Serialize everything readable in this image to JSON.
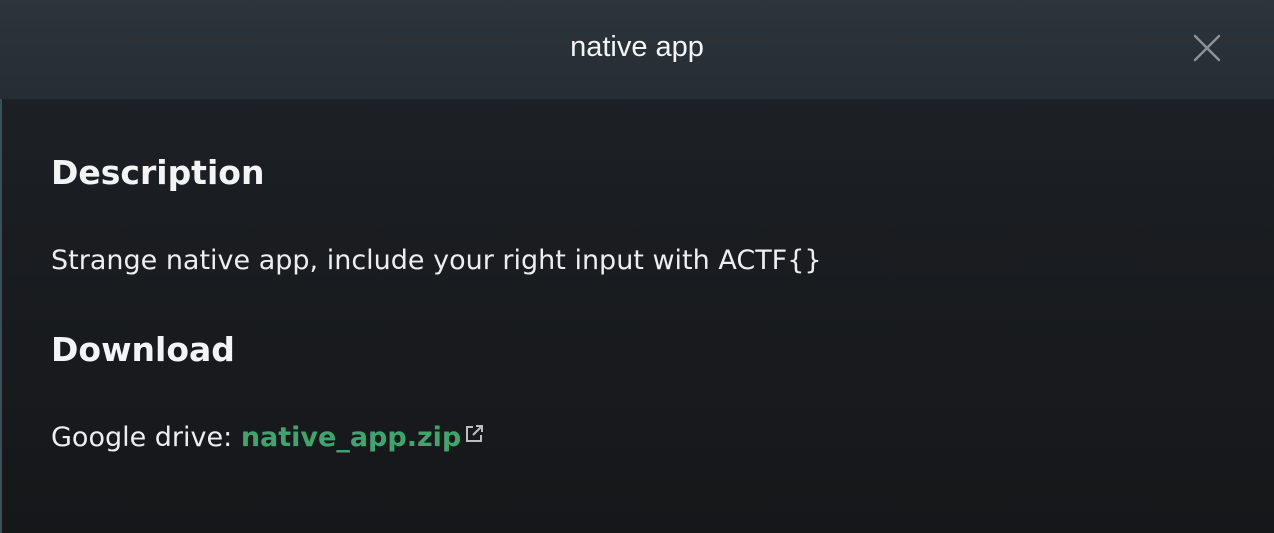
{
  "modal": {
    "title": "native app",
    "close_icon": "close-icon"
  },
  "description": {
    "heading": "Description",
    "text": "Strange native app, include your right input with ACTF{}"
  },
  "download": {
    "heading": "Download",
    "label": "Google drive: ",
    "link_text": "native_app.zip",
    "link_icon": "external-link-icon"
  },
  "colors": {
    "link": "#3fa46e",
    "header_bg": "#2c353c",
    "body_bg": "#17181b",
    "text": "#f1f2f3"
  }
}
